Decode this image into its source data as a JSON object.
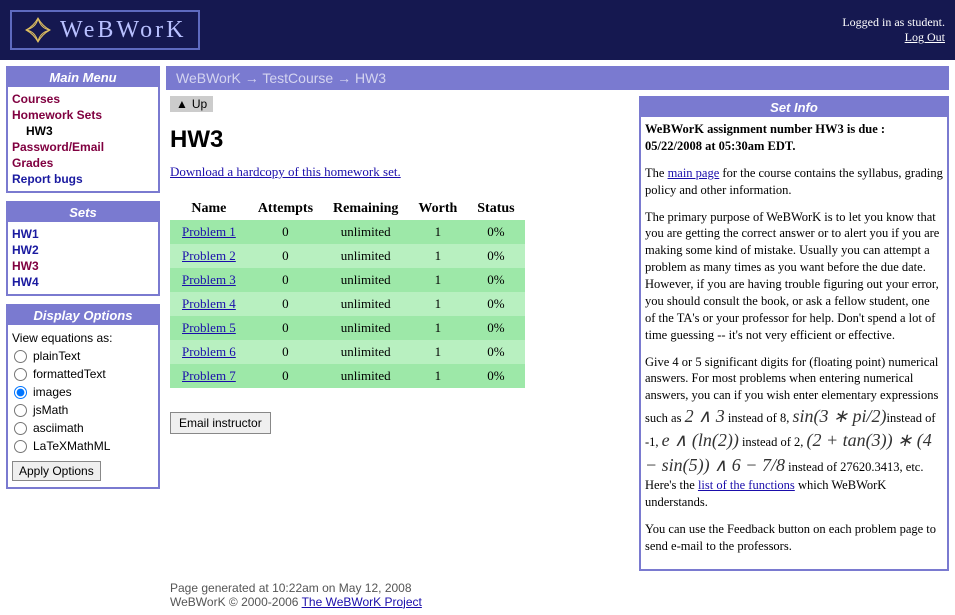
{
  "header": {
    "logo_text": "WeBWorK",
    "logged_in": "Logged in as student.",
    "logout": "Log Out"
  },
  "main_menu": {
    "title": "Main Menu",
    "items": [
      {
        "label": "Courses",
        "indent": false
      },
      {
        "label": "Homework Sets",
        "indent": false
      },
      {
        "label": "HW3",
        "indent": true
      },
      {
        "label": "Password/Email",
        "indent": false
      },
      {
        "label": "Grades",
        "indent": false
      },
      {
        "label": "Report bugs",
        "indent": false,
        "blue": true
      }
    ]
  },
  "sets": {
    "title": "Sets",
    "items": [
      "HW1",
      "HW2",
      "HW3",
      "HW4"
    ],
    "current": "HW3"
  },
  "display_options": {
    "title": "Display Options",
    "label": "View equations as:",
    "options": [
      "plainText",
      "formattedText",
      "images",
      "jsMath",
      "asciimath",
      "LaTeXMathML"
    ],
    "selected": "images",
    "apply": "Apply Options"
  },
  "breadcrumb": {
    "parts": [
      "WeBWorK",
      "TestCourse",
      "HW3"
    ],
    "sep": " → "
  },
  "up_label": "Up",
  "page_title": "HW3",
  "download_link": "Download a hardcopy of this homework set.",
  "table": {
    "headers": [
      "Name",
      "Attempts",
      "Remaining",
      "Worth",
      "Status"
    ],
    "rows": [
      {
        "name": "Problem 1",
        "attempts": "0",
        "remaining": "unlimited",
        "worth": "1",
        "status": "0%"
      },
      {
        "name": "Problem 2",
        "attempts": "0",
        "remaining": "unlimited",
        "worth": "1",
        "status": "0%"
      },
      {
        "name": "Problem 3",
        "attempts": "0",
        "remaining": "unlimited",
        "worth": "1",
        "status": "0%"
      },
      {
        "name": "Problem 4",
        "attempts": "0",
        "remaining": "unlimited",
        "worth": "1",
        "status": "0%"
      },
      {
        "name": "Problem 5",
        "attempts": "0",
        "remaining": "unlimited",
        "worth": "1",
        "status": "0%"
      },
      {
        "name": "Problem 6",
        "attempts": "0",
        "remaining": "unlimited",
        "worth": "1",
        "status": "0%"
      },
      {
        "name": "Problem 7",
        "attempts": "0",
        "remaining": "unlimited",
        "worth": "1",
        "status": "0%"
      }
    ]
  },
  "email_button": "Email instructor",
  "set_info": {
    "title": "Set Info",
    "due_line": "WeBWorK assignment number HW3 is due : 05/22/2008 at 05:30am EDT.",
    "p1_before": "The ",
    "p1_link": "main page",
    "p1_after": " for the course contains the syllabus, grading policy and other information.",
    "p2": "The primary purpose of WeBWorK is to let you know that you are getting the correct answer or to alert you if you are making some kind of mistake. Usually you can attempt a problem as many times as you want before the due date. However, if you are having trouble figuring out your error, you should consult the book, or ask a fellow student, one of the TA's or your professor for help. Don't spend a lot of time guessing -- it's not very efficient or effective.",
    "p3_a": "Give 4 or 5 significant digits for (floating point) numerical answers. For most problems when entering numerical answers, you can if you wish enter elementary expressions such as ",
    "p3_m1": "2 ∧ 3",
    "p3_b": " instead of 8, ",
    "p3_m2": "sin(3 ∗ pi/2)",
    "p3_c": "instead of -1, ",
    "p3_m3": "e ∧ (ln(2))",
    "p3_d": " instead of 2, ",
    "p3_m4": "(2 + tan(3)) ∗ (4 − sin(5)) ∧ 6 − 7/8",
    "p3_e": " instead of 27620.3413, etc. Here's the ",
    "p3_link": "list of the functions",
    "p3_f": " which WeBWorK understands.",
    "p4": "You can use the Feedback button on each problem page to send e-mail to the professors."
  },
  "footer": {
    "generated": "Page generated at 10:22am on May 12, 2008",
    "copyright_before": "WeBWorK © 2000-2006 ",
    "copyright_link": "The WeBWorK Project"
  }
}
